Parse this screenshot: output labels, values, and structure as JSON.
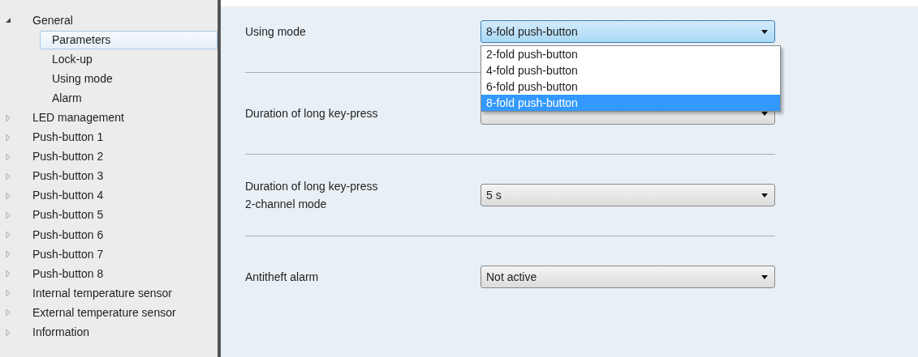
{
  "sidebar": {
    "items": [
      {
        "label": "General",
        "expanded": true,
        "children": [
          {
            "label": "Parameters",
            "selected": true
          },
          {
            "label": "Lock-up",
            "selected": false
          },
          {
            "label": "Using mode",
            "selected": false
          },
          {
            "label": "Alarm",
            "selected": false
          }
        ]
      },
      {
        "label": "LED management",
        "expanded": false
      },
      {
        "label": "Push-button 1",
        "expanded": false
      },
      {
        "label": "Push-button 2",
        "expanded": false
      },
      {
        "label": "Push-button 3",
        "expanded": false
      },
      {
        "label": "Push-button 4",
        "expanded": false
      },
      {
        "label": "Push-button 5",
        "expanded": false
      },
      {
        "label": "Push-button 6",
        "expanded": false
      },
      {
        "label": "Push-button 7",
        "expanded": false
      },
      {
        "label": "Push-button 8",
        "expanded": false
      },
      {
        "label": "Internal temperature sensor",
        "expanded": false
      },
      {
        "label": "External temperature sensor",
        "expanded": false
      },
      {
        "label": "Information",
        "expanded": false
      }
    ]
  },
  "parameters": [
    {
      "label": "Using mode",
      "value": "8-fold push-button",
      "open": true,
      "options": [
        {
          "label": "2-fold push-button",
          "selected": false
        },
        {
          "label": "4-fold push-button",
          "selected": false
        },
        {
          "label": "6-fold push-button",
          "selected": false
        },
        {
          "label": "8-fold push-button",
          "selected": true
        }
      ]
    },
    {
      "label": "Duration of long key-press",
      "open": false
    },
    {
      "label": "Duration of long key-press\n2-channel mode",
      "value": "5 s",
      "open": false
    },
    {
      "label": "Antitheft alarm",
      "value": "Not active",
      "open": false
    }
  ]
}
